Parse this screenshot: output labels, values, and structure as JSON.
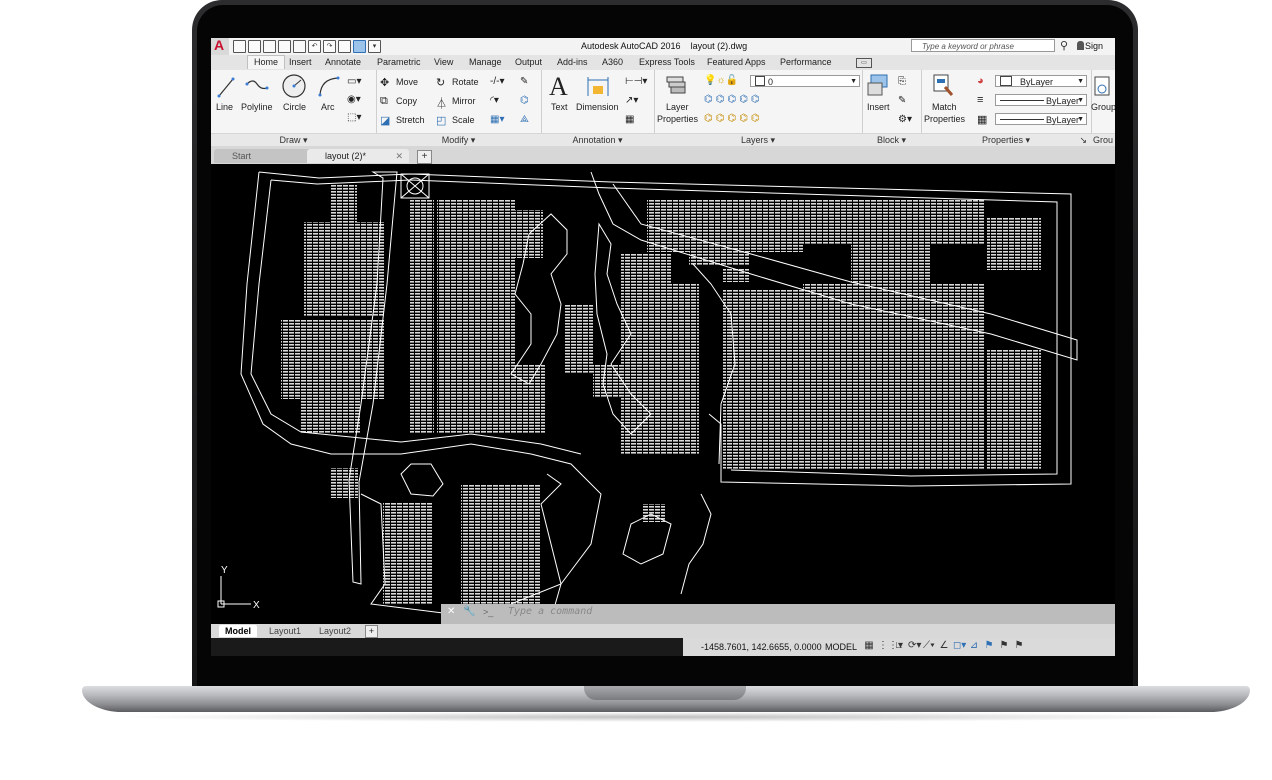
{
  "window": {
    "title": "Autodesk AutoCAD 2016    layout (2).dwg",
    "search_placeholder": "Type a keyword or phrase",
    "signin": "Sign"
  },
  "ribbon_tabs": [
    "Home",
    "Insert",
    "Annotate",
    "Parametric",
    "View",
    "Manage",
    "Output",
    "Add-ins",
    "A360",
    "Express Tools",
    "Featured Apps",
    "Performance"
  ],
  "draw_panel": {
    "title": "Draw",
    "line": "Line",
    "polyline": "Polyline",
    "circle": "Circle",
    "arc": "Arc"
  },
  "modify_panel": {
    "title": "Modify",
    "move": "Move",
    "rotate": "Rotate",
    "copy": "Copy",
    "mirror": "Mirror",
    "stretch": "Stretch",
    "scale": "Scale"
  },
  "annotation_panel": {
    "title": "Annotation",
    "text": "Text",
    "dimension": "Dimension"
  },
  "layers_panel": {
    "title": "Layers",
    "layer_properties_1": "Layer",
    "layer_properties_2": "Properties",
    "current_layer": "0"
  },
  "block_panel": {
    "title": "Block",
    "insert": "Insert"
  },
  "properties_panel": {
    "title": "Properties",
    "match_1": "Match",
    "match_2": "Properties",
    "color": "ByLayer",
    "linetype": "ByLayer",
    "lineweight": "ByLayer"
  },
  "groups_panel": {
    "title": "Grou",
    "group": "Group"
  },
  "file_tabs": {
    "start": "Start",
    "current": "layout (2)*"
  },
  "command": {
    "placeholder": "Type a command",
    "prompt": ">_"
  },
  "layout_tabs": [
    "Model",
    "Layout1",
    "Layout2"
  ],
  "status": {
    "coords": "-1458.7601, 142.6655, 0.0000",
    "mode": "MODEL"
  },
  "ucs": {
    "x": "X",
    "y": "Y"
  },
  "colors": {
    "background": "#000000",
    "linework": "#ffffff",
    "ribbon": "#f5f5f5",
    "accent": "#c8102e"
  }
}
